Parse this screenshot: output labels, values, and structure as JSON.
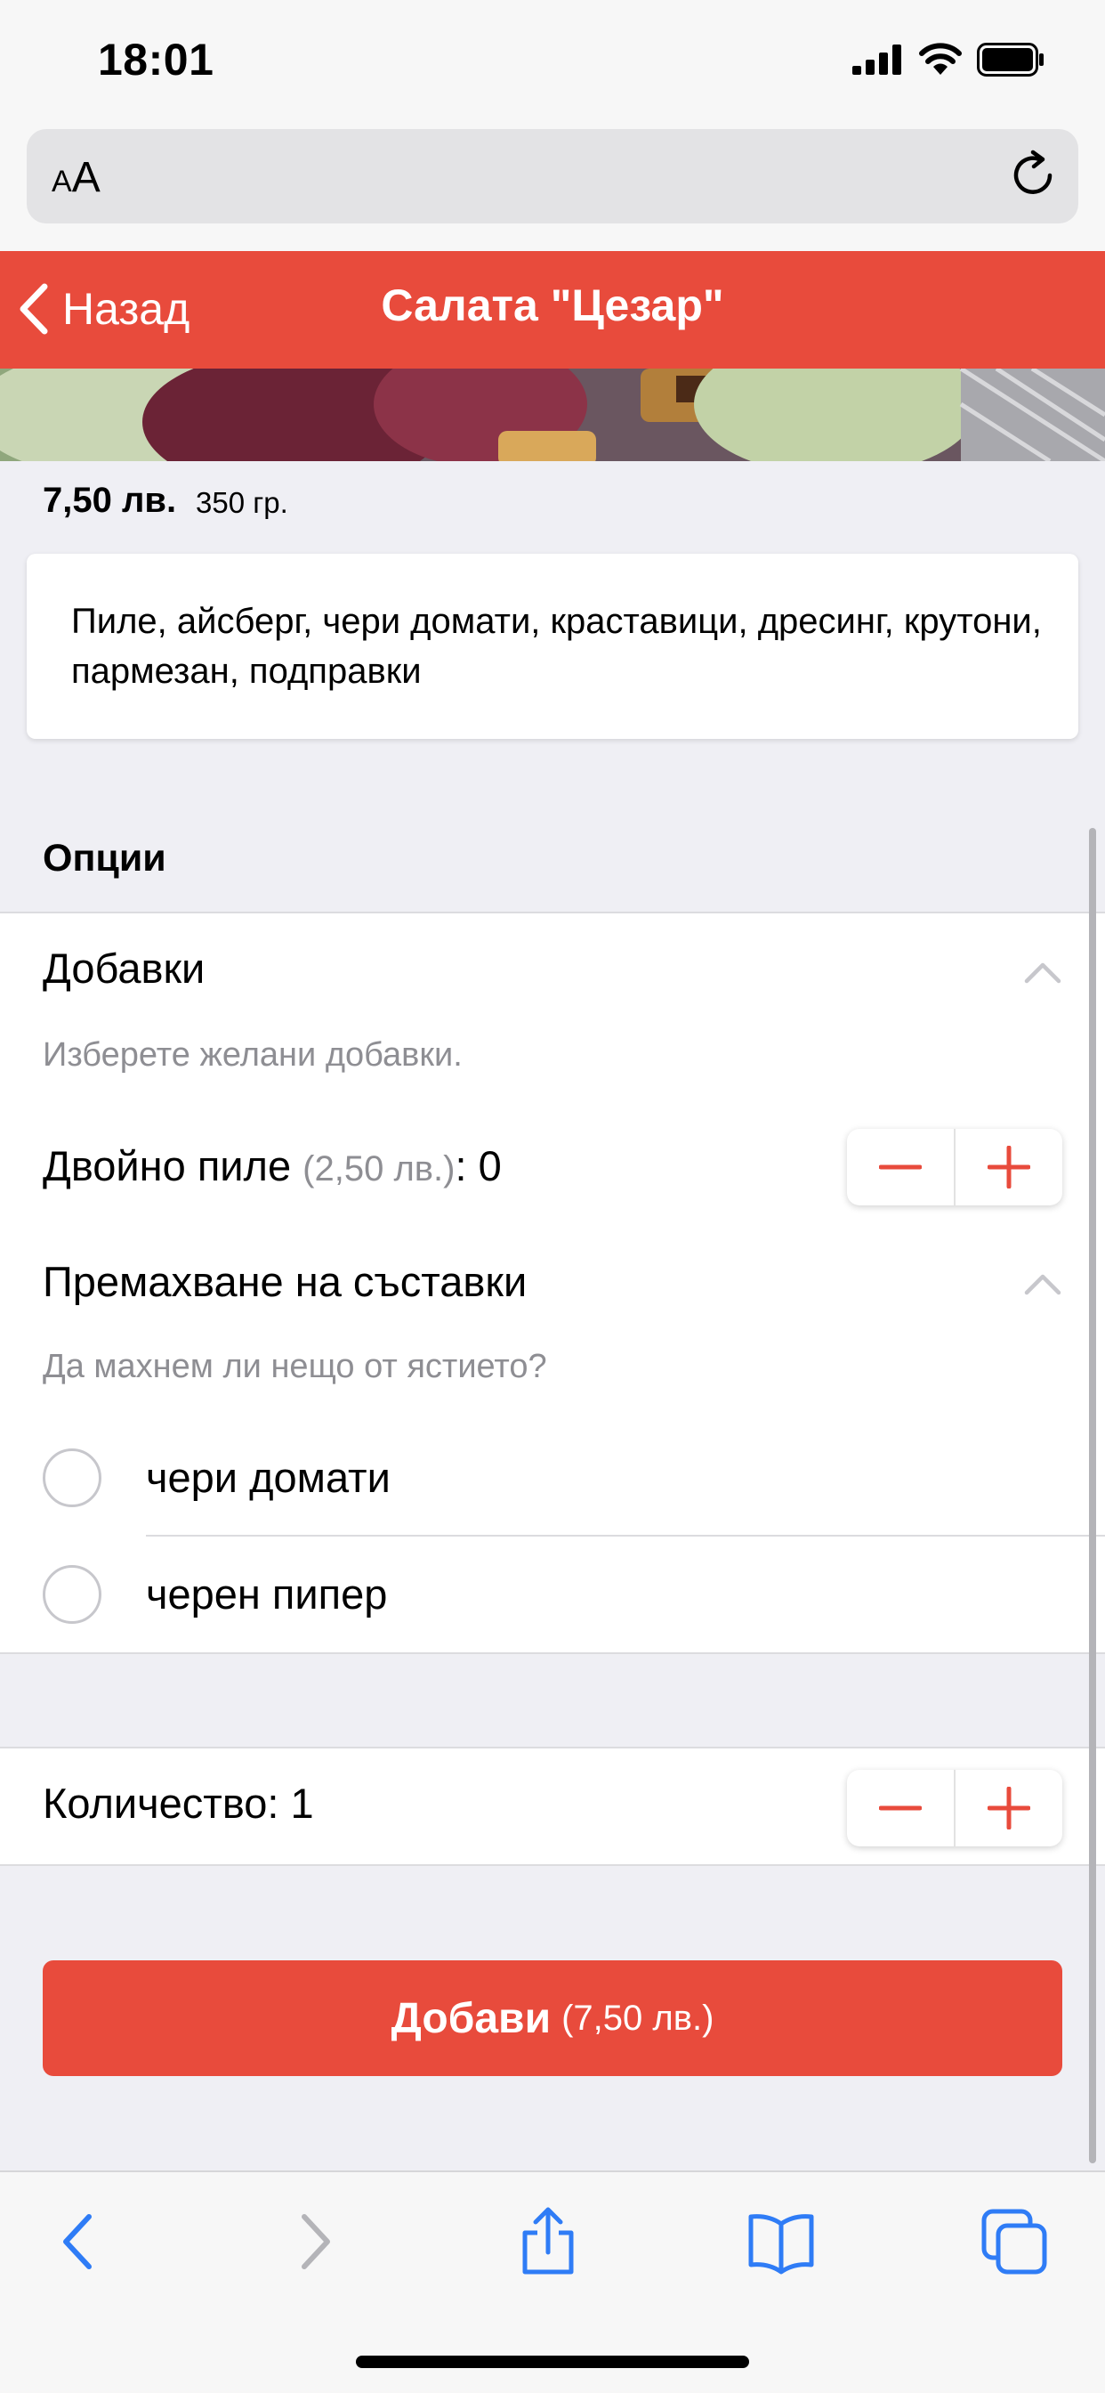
{
  "status_bar": {
    "time": "18:01"
  },
  "url_bar": {
    "text_size_small": "A",
    "text_size_large": "A"
  },
  "nav": {
    "back_label": "Назад",
    "title": "Салата \"Цезар\""
  },
  "product": {
    "price": "7,50 лв.",
    "weight": "350 гр.",
    "description": "Пиле, айсберг, чери домати, краставици, дресинг, крутони, пармезан, подправки"
  },
  "options": {
    "title": "Опции",
    "extras": {
      "title": "Добавки",
      "hint": "Изберете желани добавки.",
      "item_name": "Двойно пиле",
      "item_price": "(2,50 лв.)",
      "item_count": ": 0"
    },
    "removals": {
      "title": "Премахване на съставки",
      "hint": "Да махнем ли нещо от ястието?",
      "items": [
        {
          "label": "чери домати",
          "selected": false
        },
        {
          "label": "черен пипер",
          "selected": false
        }
      ]
    }
  },
  "quantity": {
    "label": "Количество: 1"
  },
  "add_button": {
    "label": "Добави",
    "price": "(7,50 лв.)"
  },
  "colors": {
    "accent": "#e84b3c",
    "ios_blue": "#2f7cf6",
    "background": "#efeff4"
  }
}
